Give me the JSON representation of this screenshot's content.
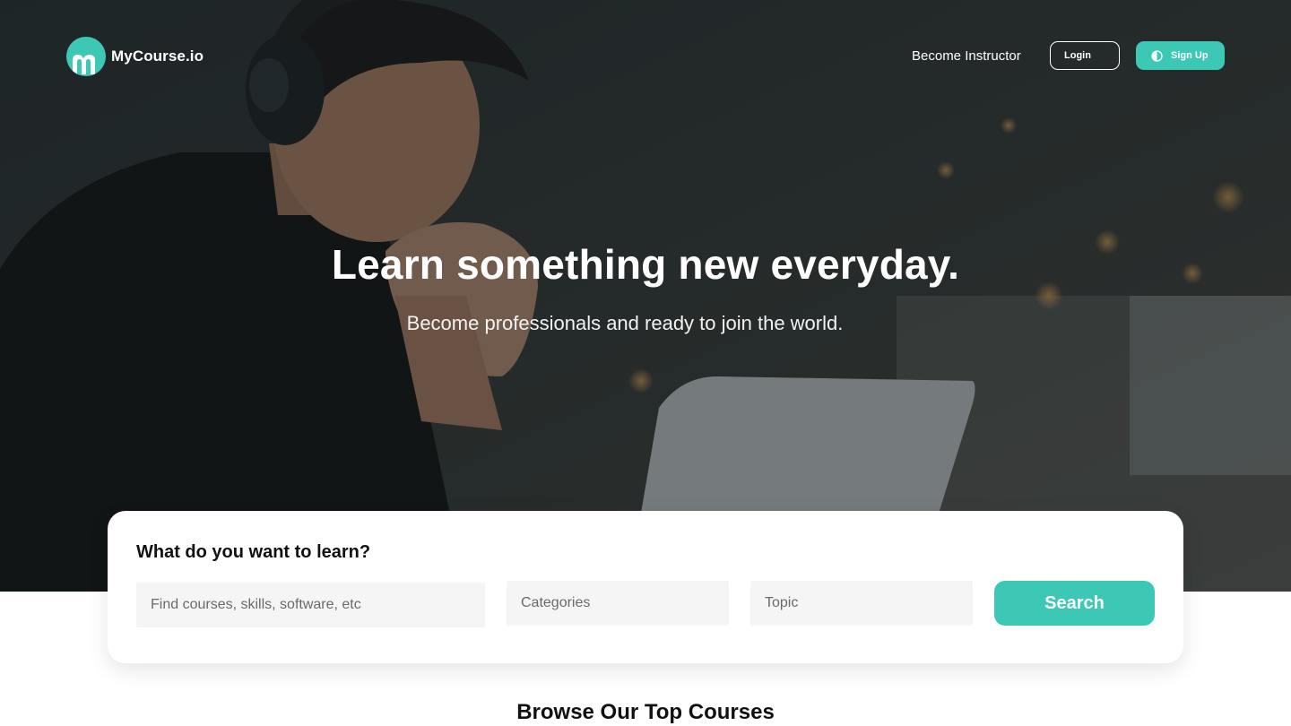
{
  "brand": {
    "name": "MyCourse.io",
    "logo_icon": "m-logo-icon",
    "accent_color": "#3cc8b4"
  },
  "nav": {
    "become_instructor": "Become Instructor",
    "login_label": "Login",
    "signup_label": "Sign Up",
    "signup_icon": "half-circle-icon"
  },
  "hero": {
    "title": "Learn something new everyday.",
    "subtitle": "Become professionals and ready to join the world."
  },
  "search": {
    "heading": "What do you want to learn?",
    "query_placeholder": "Find courses, skills, software, etc",
    "categories_placeholder": "Categories",
    "topic_placeholder": "Topic",
    "button_label": "Search"
  },
  "section": {
    "title": "Browse Our Top Courses"
  }
}
